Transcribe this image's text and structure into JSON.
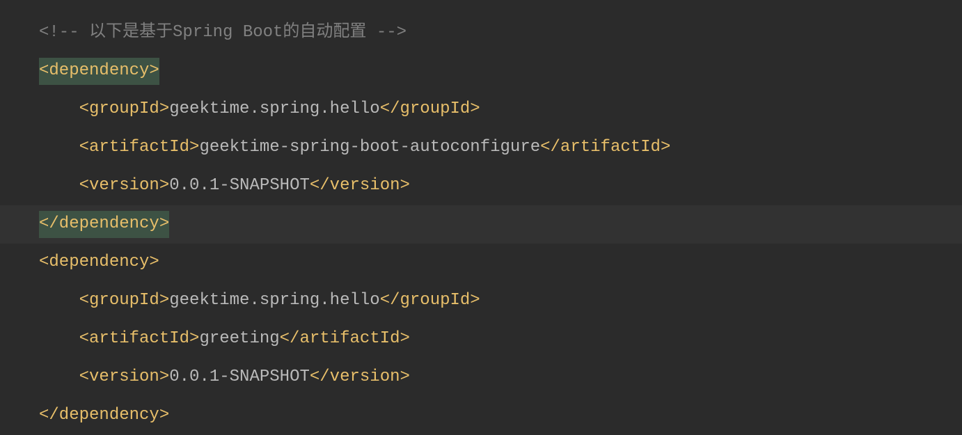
{
  "code": {
    "comment": "<!-- 以下是基于Spring Boot的自动配置 -->",
    "dep1": {
      "open": "<dependency>",
      "groupId": {
        "openTag": "<groupId>",
        "text": "geektime.spring.hello",
        "closeTag": "</groupId>"
      },
      "artifactId": {
        "openTag": "<artifactId>",
        "text": "geektime-spring-boot-autoconfigure",
        "closeTag": "</artifactId>"
      },
      "version": {
        "openTag": "<version>",
        "text": "0.0.1-SNAPSHOT",
        "closeTag": "</version>"
      },
      "close": "</dependency>"
    },
    "dep2": {
      "open": "<dependency>",
      "groupId": {
        "openTag": "<groupId>",
        "text": "geektime.spring.hello",
        "closeTag": "</groupId>"
      },
      "artifactId": {
        "openTag": "<artifactId>",
        "text": "greeting",
        "closeTag": "</artifactId>"
      },
      "version": {
        "openTag": "<version>",
        "text": "0.0.1-SNAPSHOT",
        "closeTag": "</version>"
      },
      "close": "</dependency>"
    }
  }
}
